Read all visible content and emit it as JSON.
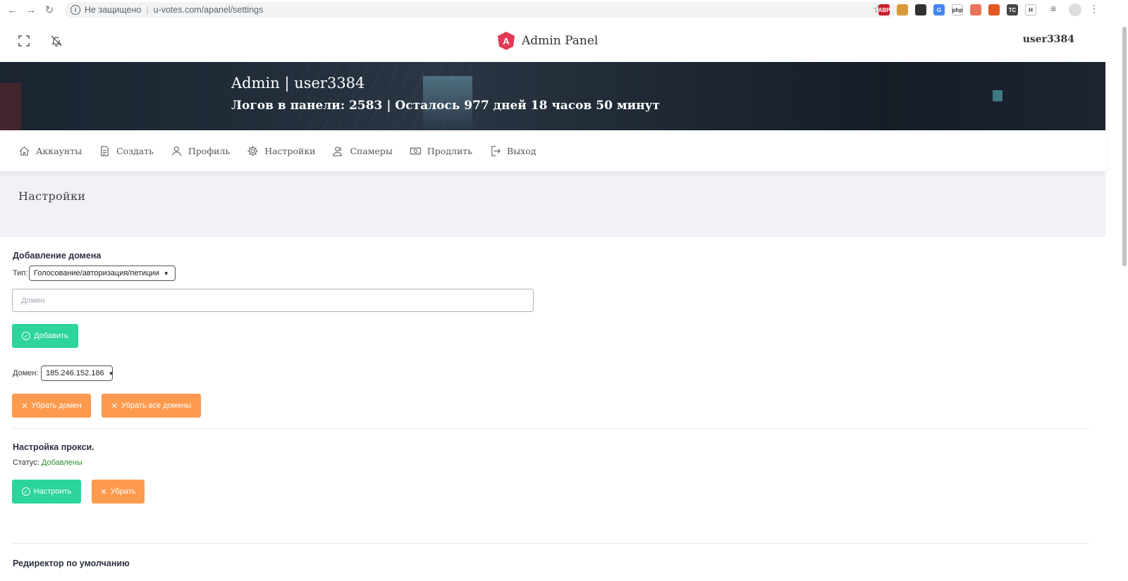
{
  "browser": {
    "not_secure": "Не защищено",
    "separator": "|",
    "url": "u-votes.com/apanel/settings",
    "extensions": [
      {
        "name": "abp-icon",
        "label": "ABP",
        "color": "#c8202f"
      },
      {
        "name": "cookie-icon",
        "label": "",
        "color": "#d89a3a"
      },
      {
        "name": "block-icon",
        "label": "",
        "color": "#333333"
      },
      {
        "name": "translate-icon",
        "label": "G",
        "color": "#4285f4"
      },
      {
        "name": "php-icon",
        "label": "php",
        "color": "#ffffff"
      },
      {
        "name": "camera-icon",
        "label": "",
        "color": "#e8755a"
      },
      {
        "name": "tab-icon",
        "label": "",
        "color": "#e25822"
      },
      {
        "name": "tc-icon",
        "label": "TC",
        "color": "#444444"
      },
      {
        "name": "h-icon",
        "label": "H",
        "color": "#ffffff"
      }
    ]
  },
  "header": {
    "brand": "Admin Panel",
    "user": "user3384"
  },
  "banner": {
    "title": "Admin | user3384",
    "subtitle": "Логов в панели: 2583 | Осталось 977 дней 18 часов 50 минут"
  },
  "menu": {
    "items": [
      {
        "label": "Аккаунты",
        "icon": "home-icon"
      },
      {
        "label": "Создать",
        "icon": "document-icon"
      },
      {
        "label": "Профиль",
        "icon": "user-icon"
      },
      {
        "label": "Настройки",
        "icon": "gear-icon"
      },
      {
        "label": "Спамеры",
        "icon": "users-icon"
      },
      {
        "label": "Продлить",
        "icon": "money-icon"
      },
      {
        "label": "Выход",
        "icon": "logout-icon"
      }
    ]
  },
  "page": {
    "title": "Настройки"
  },
  "domain_section": {
    "title": "Добавление домена",
    "type_label": "Тип:",
    "type_value": "Голосование/авторизация/петиции",
    "domain_placeholder": "Домен",
    "add_button": "Добавить",
    "domain_label": "Домен:",
    "domain_value": "185.246.152.186",
    "remove_button": "Убрать домен",
    "remove_all_button": "Убрать все домены"
  },
  "proxy_section": {
    "title": "Настройка прокси.",
    "status_label": "Статус:",
    "status_value": "Добавлены",
    "configure_button": "Настроить",
    "remove_button": "Убрать"
  },
  "redirect_section": {
    "title": "Редиректор по умолчанию"
  }
}
